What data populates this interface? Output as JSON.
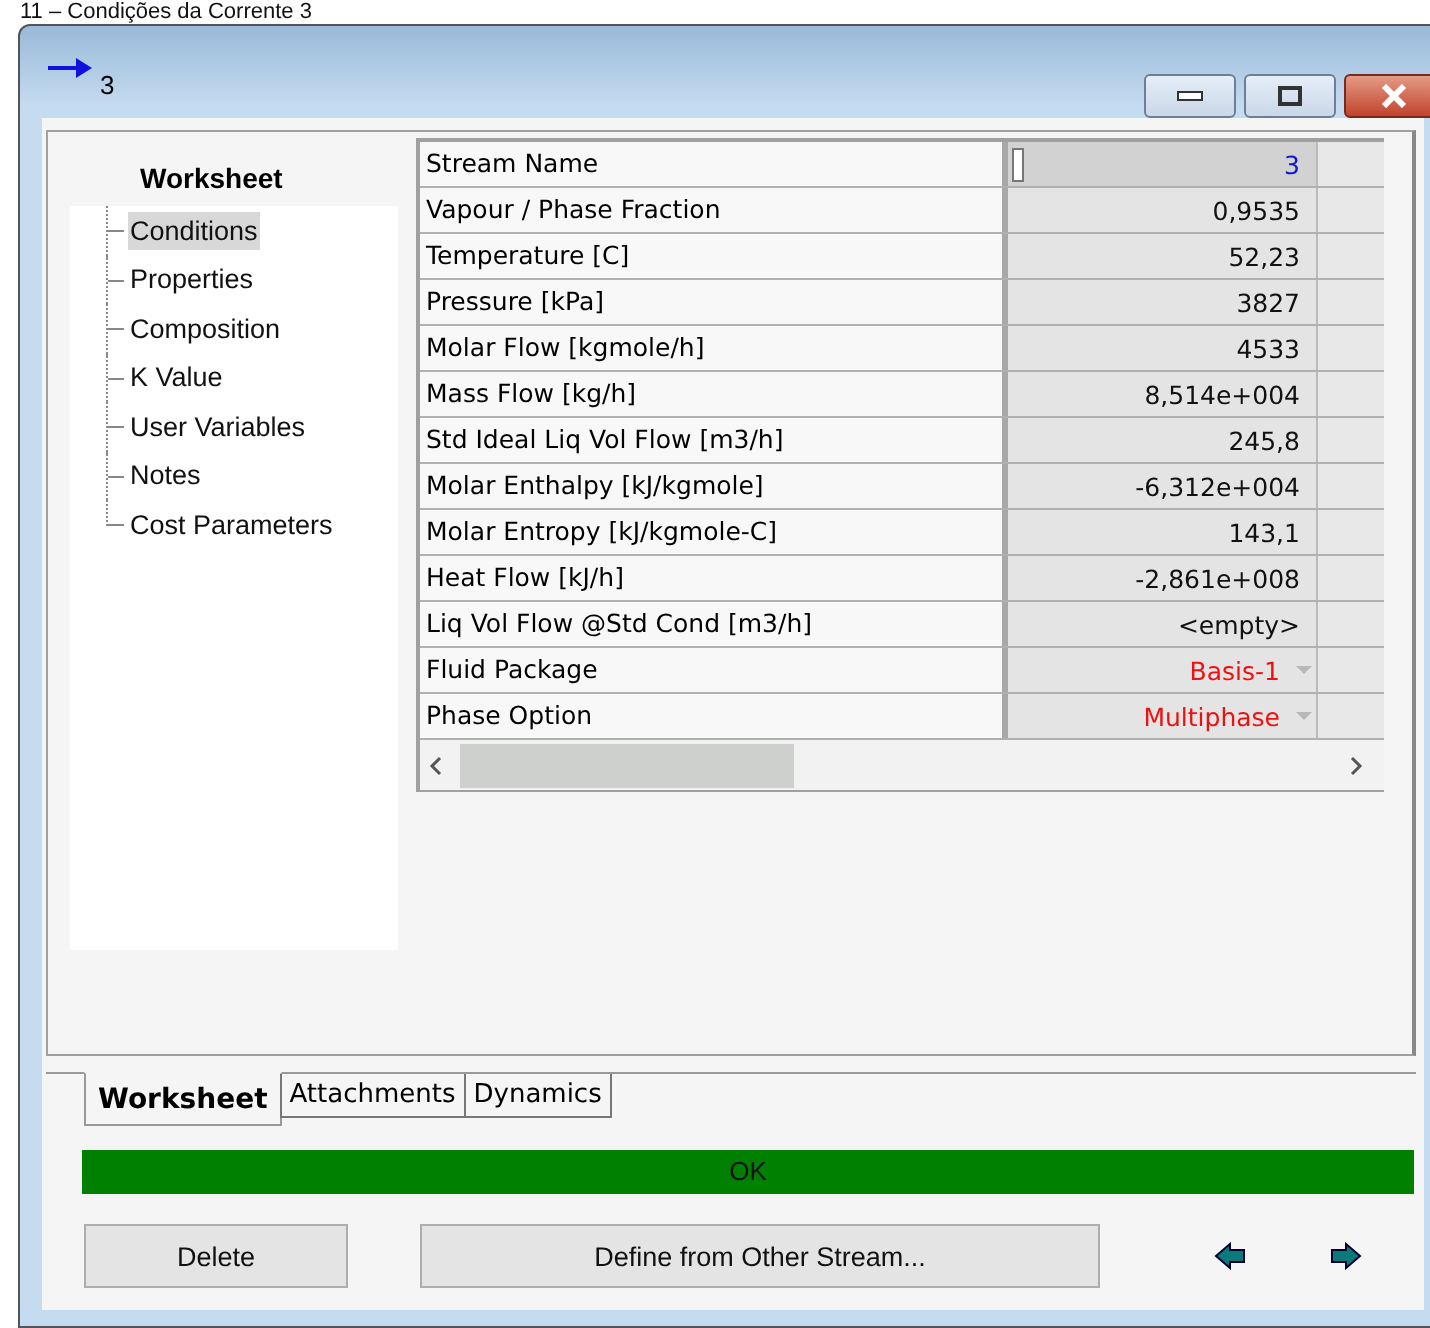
{
  "caption": "11 – Condições da Corrente 3",
  "window": {
    "title": "3"
  },
  "sidebar": {
    "heading": "Worksheet",
    "items": [
      {
        "label": "Conditions",
        "selected": true
      },
      {
        "label": "Properties",
        "selected": false
      },
      {
        "label": "Composition",
        "selected": false
      },
      {
        "label": "K Value",
        "selected": false
      },
      {
        "label": "User Variables",
        "selected": false
      },
      {
        "label": "Notes",
        "selected": false
      },
      {
        "label": "Cost Parameters",
        "selected": false
      }
    ]
  },
  "table": {
    "rows": [
      {
        "label": "Stream Name",
        "value": "3",
        "kind": "name"
      },
      {
        "label": "Vapour / Phase Fraction",
        "value": "0,9535",
        "kind": "number"
      },
      {
        "label": "Temperature [C]",
        "value": "52,23",
        "kind": "number"
      },
      {
        "label": "Pressure [kPa]",
        "value": "3827",
        "kind": "number"
      },
      {
        "label": "Molar Flow [kgmole/h]",
        "value": "4533",
        "kind": "number"
      },
      {
        "label": "Mass Flow [kg/h]",
        "value": "8,514e+004",
        "kind": "number"
      },
      {
        "label": "Std Ideal Liq Vol Flow [m3/h]",
        "value": "245,8",
        "kind": "number"
      },
      {
        "label": "Molar Enthalpy [kJ/kgmole]",
        "value": "-6,312e+004",
        "kind": "number"
      },
      {
        "label": "Molar Entropy [kJ/kgmole-C]",
        "value": "143,1",
        "kind": "number"
      },
      {
        "label": "Heat Flow [kJ/h]",
        "value": "-2,861e+008",
        "kind": "number"
      },
      {
        "label": "Liq Vol Flow @Std Cond [m3/h]",
        "value": "<empty>",
        "kind": "number"
      },
      {
        "label": "Fluid Package",
        "value": "Basis-1",
        "kind": "choice"
      },
      {
        "label": "Phase Option",
        "value": "Multiphase",
        "kind": "choice"
      }
    ]
  },
  "tabs": [
    {
      "label": "Worksheet",
      "selected": true
    },
    {
      "label": "Attachments",
      "selected": false
    },
    {
      "label": "Dynamics",
      "selected": false
    }
  ],
  "status_bar": {
    "text": "OK"
  },
  "buttons": [
    "Delete",
    "Define from Other Stream..."
  ]
}
